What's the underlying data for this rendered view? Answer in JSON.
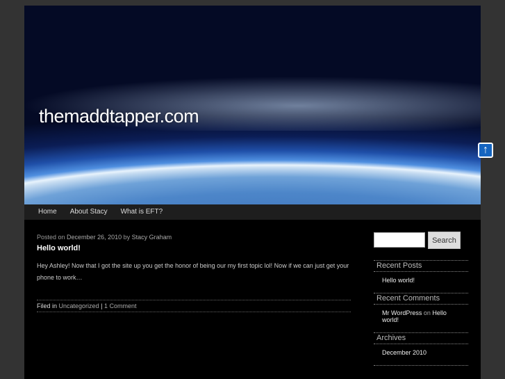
{
  "site": {
    "title": "themaddtapper.com"
  },
  "nav": [
    "Home",
    "About Stacy",
    "What is EFT?"
  ],
  "post": {
    "posted_on": "Posted on",
    "date": "December 26, 2010",
    "by": "by",
    "author": "Stacy Graham",
    "title": "Hello world!",
    "body": "Hey Ashley!  Now that I got the site up you get the honor of being our my first topic lol!   Now if we can just get your phone to work…",
    "filed_in": "Filed in",
    "category": "Uncategorized",
    "sep": "|",
    "comments": "1 Comment"
  },
  "sidebar": {
    "search_button": "Search",
    "search_value": "",
    "recent_posts_title": "Recent Posts",
    "recent_posts": [
      "Hello world!"
    ],
    "recent_comments_title": "Recent Comments",
    "comment_author": "Mr WordPress",
    "comment_on": "on",
    "comment_post": "Hello world!",
    "archives_title": "Archives",
    "archives": [
      "December 2010"
    ]
  }
}
